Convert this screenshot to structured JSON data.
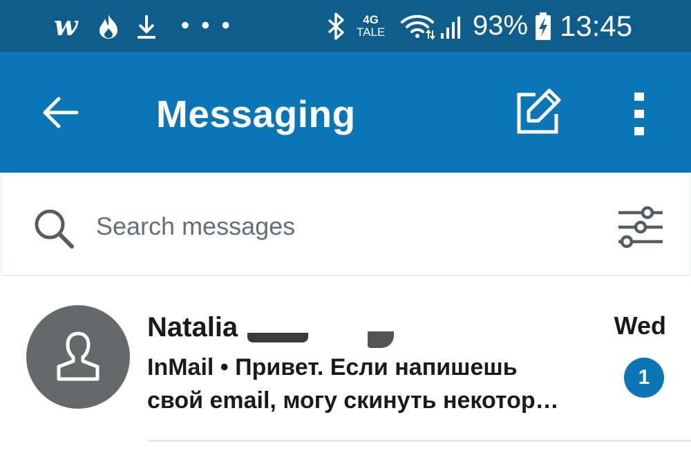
{
  "status_bar": {
    "app_icon_letter": "w",
    "overflow_dots": "• • •",
    "network_type": "4G",
    "network_sub": "TALE",
    "battery_percent": "93%",
    "time": "13:45",
    "icons": [
      "wish-icon",
      "flame-icon",
      "download-icon",
      "more-notifications-icon",
      "bluetooth-icon",
      "wifi-icon",
      "signal-icon",
      "battery-charging-icon"
    ]
  },
  "app_bar": {
    "title": "Messaging",
    "icons": [
      "back-arrow-icon",
      "compose-icon",
      "more-vertical-icon"
    ]
  },
  "search": {
    "placeholder": "Search messages",
    "value": "",
    "icons": [
      "search-icon",
      "filter-sliders-icon"
    ]
  },
  "conversations": [
    {
      "sender": "Natalia",
      "preview_line1": "InMail • Привет. Если напишешь",
      "preview_line2": "свой email, могу скинуть некотор…",
      "time": "Wed",
      "unread_count": "1"
    }
  ],
  "colors": {
    "status_bar": "#0f5d8b",
    "app_bar": "#0b76b5",
    "badge": "#0b76b5",
    "avatar_bg": "#666869"
  }
}
